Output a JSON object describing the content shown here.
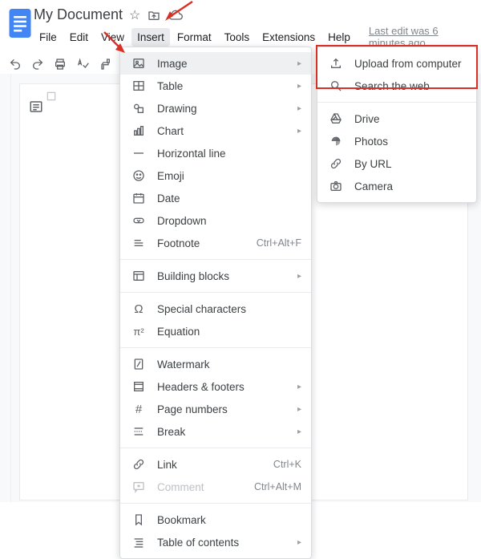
{
  "header": {
    "title": "My Document",
    "last_edit": "Last edit was 6 minutes ago"
  },
  "menubar": {
    "file": "File",
    "edit": "Edit",
    "view": "View",
    "insert": "Insert",
    "format": "Format",
    "tools": "Tools",
    "extensions": "Extensions",
    "help": "Help"
  },
  "insert_menu": {
    "image": "Image",
    "table": "Table",
    "drawing": "Drawing",
    "chart": "Chart",
    "horizontal_line": "Horizontal line",
    "emoji": "Emoji",
    "date": "Date",
    "dropdown": "Dropdown",
    "footnote": "Footnote",
    "footnote_hint": "Ctrl+Alt+F",
    "building_blocks": "Building blocks",
    "special_characters": "Special characters",
    "equation": "Equation",
    "watermark": "Watermark",
    "headers_footers": "Headers & footers",
    "page_numbers": "Page numbers",
    "break": "Break",
    "link": "Link",
    "link_hint": "Ctrl+K",
    "comment": "Comment",
    "comment_hint": "Ctrl+Alt+M",
    "bookmark": "Bookmark",
    "toc": "Table of contents"
  },
  "image_submenu": {
    "upload": "Upload from computer",
    "search": "Search the web",
    "drive": "Drive",
    "photos": "Photos",
    "by_url": "By URL",
    "camera": "Camera"
  }
}
